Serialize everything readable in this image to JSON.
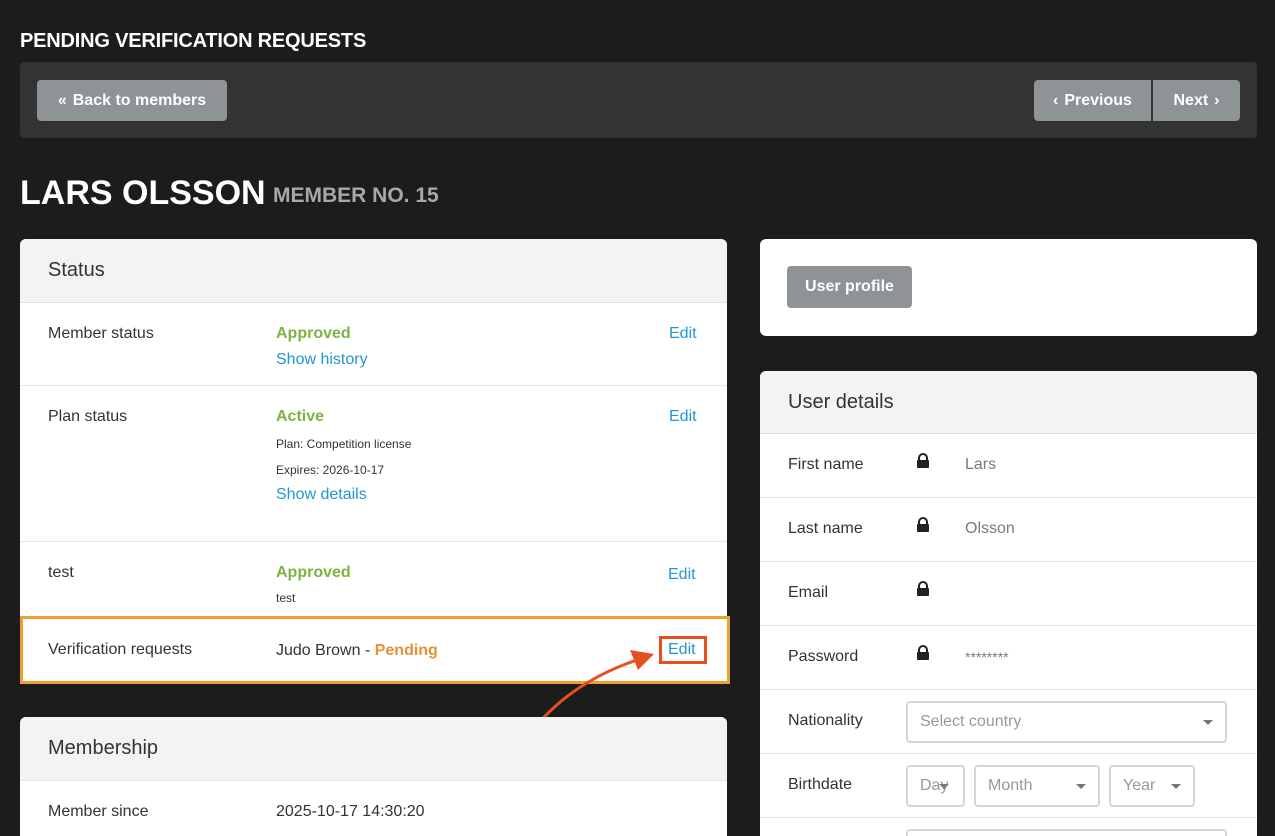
{
  "header": {
    "title": "PENDING VERIFICATION REQUESTS",
    "back_label": "Back to members",
    "previous_label": "Previous",
    "next_label": "Next"
  },
  "member": {
    "name": "LARS OLSSON",
    "number_label": "MEMBER NO. 15"
  },
  "status_panel": {
    "title": "Status",
    "edit_label": "Edit",
    "rows": [
      {
        "label": "Member status",
        "value": "Approved",
        "link": "Show history"
      },
      {
        "label": "Plan status",
        "value": "Active",
        "plan": "Plan: Competition license",
        "expires": "Expires: 2026-10-17",
        "link": "Show details"
      },
      {
        "label": "test",
        "value": "Approved",
        "note": "test"
      },
      {
        "label": "Verification requests",
        "request": "Judo Brown - ",
        "request_status": "Pending"
      }
    ]
  },
  "membership_panel": {
    "title": "Membership",
    "since_label": "Member since",
    "since_value": "2025-10-17 14:30:20"
  },
  "profile_panel": {
    "button_label": "User profile"
  },
  "details_panel": {
    "title": "User details",
    "rows": [
      {
        "label": "First name",
        "value": "Lars"
      },
      {
        "label": "Last name",
        "value": "Olsson"
      },
      {
        "label": "Email",
        "value": ""
      },
      {
        "label": "Password",
        "value": "********"
      }
    ],
    "nationality_label": "Nationality",
    "nationality_placeholder": "Select country",
    "birthdate_label": "Birthdate",
    "day_placeholder": "Day",
    "month_placeholder": "Month",
    "year_placeholder": "Year"
  },
  "colors": {
    "approved": "#7cb342",
    "pending": "#e6913a",
    "link": "#2196d3",
    "highlight": "#f0a030",
    "annotation": "#e84f20"
  }
}
